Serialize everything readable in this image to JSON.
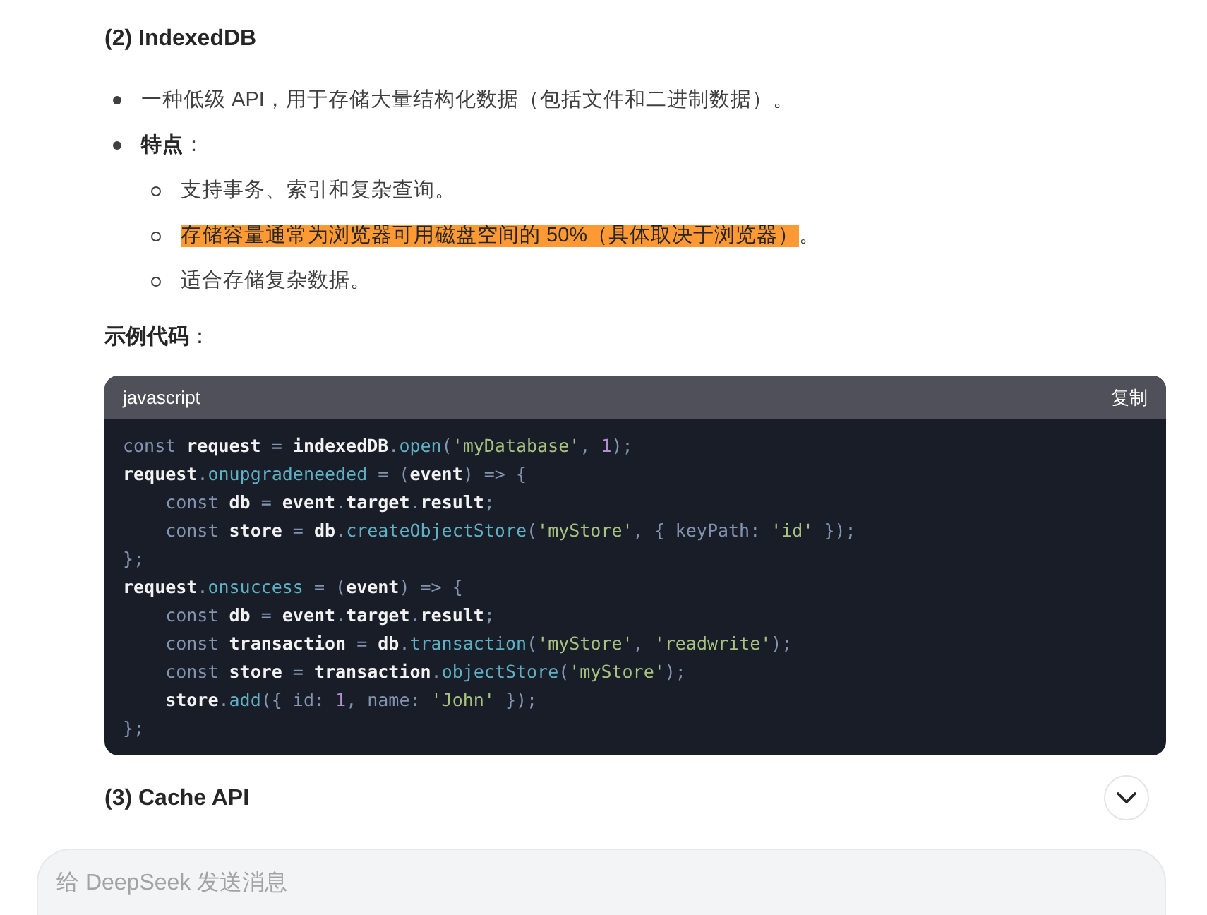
{
  "heading": "(2) IndexedDB",
  "bullets": [
    {
      "segments": [
        {
          "text": "一种低级 API，用于存储大量结构化数据（包括文件和二进制数据）。",
          "highlighted": false
        }
      ],
      "bold": false
    },
    {
      "segments": [
        {
          "text": "特点",
          "highlighted": false
        }
      ],
      "bold": true,
      "suffix": "：",
      "children": [
        {
          "segments": [
            {
              "text": "支持事务、索引和复杂查询。",
              "highlighted": false
            }
          ]
        },
        {
          "segments": [
            {
              "text": "存储容量通常为浏览器可用磁盘空间的 50%（具体取决于浏览器）",
              "highlighted": true
            },
            {
              "text": "。",
              "highlighted": false
            }
          ]
        },
        {
          "segments": [
            {
              "text": "适合存储复杂数据。",
              "highlighted": false
            }
          ]
        }
      ]
    }
  ],
  "example_label": "示例代码",
  "example_suffix": "：",
  "code_block": {
    "language": "javascript",
    "copy_label": "复制",
    "lines": [
      {
        "tokens": [
          {
            "kind": "kw",
            "text": "const "
          },
          {
            "kind": "id",
            "text": "request"
          },
          {
            "kind": "p",
            "text": " = "
          },
          {
            "kind": "id",
            "text": "indexedDB"
          },
          {
            "kind": "p",
            "text": "."
          },
          {
            "kind": "prop",
            "text": "open"
          },
          {
            "kind": "p",
            "text": "("
          },
          {
            "kind": "str",
            "text": "'myDatabase'"
          },
          {
            "kind": "p",
            "text": ", "
          },
          {
            "kind": "num",
            "text": "1"
          },
          {
            "kind": "p",
            "text": ");"
          }
        ]
      },
      {
        "tokens": [
          {
            "kind": "id",
            "text": "request"
          },
          {
            "kind": "p",
            "text": "."
          },
          {
            "kind": "prop",
            "text": "onupgradeneeded"
          },
          {
            "kind": "p",
            "text": " = ("
          },
          {
            "kind": "id",
            "text": "event"
          },
          {
            "kind": "p",
            "text": ") => {"
          }
        ]
      },
      {
        "tokens": [
          {
            "kind": "kw",
            "text": "    const "
          },
          {
            "kind": "id",
            "text": "db"
          },
          {
            "kind": "p",
            "text": " = "
          },
          {
            "kind": "id",
            "text": "event"
          },
          {
            "kind": "p",
            "text": "."
          },
          {
            "kind": "id",
            "text": "target"
          },
          {
            "kind": "p",
            "text": "."
          },
          {
            "kind": "id",
            "text": "result"
          },
          {
            "kind": "p",
            "text": ";"
          }
        ]
      },
      {
        "tokens": [
          {
            "kind": "kw",
            "text": "    const "
          },
          {
            "kind": "id",
            "text": "store"
          },
          {
            "kind": "p",
            "text": " = "
          },
          {
            "kind": "id",
            "text": "db"
          },
          {
            "kind": "p",
            "text": "."
          },
          {
            "kind": "prop",
            "text": "createObjectStore"
          },
          {
            "kind": "p",
            "text": "("
          },
          {
            "kind": "str",
            "text": "'myStore'"
          },
          {
            "kind": "p",
            "text": ", { keyPath: "
          },
          {
            "kind": "str",
            "text": "'id'"
          },
          {
            "kind": "p",
            "text": " });"
          }
        ]
      },
      {
        "tokens": [
          {
            "kind": "p",
            "text": "};"
          }
        ]
      },
      {
        "tokens": [
          {
            "kind": "id",
            "text": "request"
          },
          {
            "kind": "p",
            "text": "."
          },
          {
            "kind": "prop",
            "text": "onsuccess"
          },
          {
            "kind": "p",
            "text": " = ("
          },
          {
            "kind": "id",
            "text": "event"
          },
          {
            "kind": "p",
            "text": ") => {"
          }
        ]
      },
      {
        "tokens": [
          {
            "kind": "kw",
            "text": "    const "
          },
          {
            "kind": "id",
            "text": "db"
          },
          {
            "kind": "p",
            "text": " = "
          },
          {
            "kind": "id",
            "text": "event"
          },
          {
            "kind": "p",
            "text": "."
          },
          {
            "kind": "id",
            "text": "target"
          },
          {
            "kind": "p",
            "text": "."
          },
          {
            "kind": "id",
            "text": "result"
          },
          {
            "kind": "p",
            "text": ";"
          }
        ]
      },
      {
        "tokens": [
          {
            "kind": "kw",
            "text": "    const "
          },
          {
            "kind": "id",
            "text": "transaction"
          },
          {
            "kind": "p",
            "text": " = "
          },
          {
            "kind": "id",
            "text": "db"
          },
          {
            "kind": "p",
            "text": "."
          },
          {
            "kind": "prop",
            "text": "transaction"
          },
          {
            "kind": "p",
            "text": "("
          },
          {
            "kind": "str",
            "text": "'myStore'"
          },
          {
            "kind": "p",
            "text": ", "
          },
          {
            "kind": "str",
            "text": "'readwrite'"
          },
          {
            "kind": "p",
            "text": ");"
          }
        ]
      },
      {
        "tokens": [
          {
            "kind": "kw",
            "text": "    const "
          },
          {
            "kind": "id",
            "text": "store"
          },
          {
            "kind": "p",
            "text": " = "
          },
          {
            "kind": "id",
            "text": "transaction"
          },
          {
            "kind": "p",
            "text": "."
          },
          {
            "kind": "prop",
            "text": "objectStore"
          },
          {
            "kind": "p",
            "text": "("
          },
          {
            "kind": "str",
            "text": "'myStore'"
          },
          {
            "kind": "p",
            "text": ");"
          }
        ]
      },
      {
        "tokens": [
          {
            "kind": "id",
            "text": "    store"
          },
          {
            "kind": "p",
            "text": "."
          },
          {
            "kind": "prop",
            "text": "add"
          },
          {
            "kind": "p",
            "text": "({ id: "
          },
          {
            "kind": "num",
            "text": "1"
          },
          {
            "kind": "p",
            "text": ", name: "
          },
          {
            "kind": "str",
            "text": "'John'"
          },
          {
            "kind": "p",
            "text": " });"
          }
        ]
      },
      {
        "tokens": [
          {
            "kind": "p",
            "text": "};"
          }
        ]
      }
    ]
  },
  "next_heading": "(3) Cache API",
  "message_input": {
    "placeholder": "给 DeepSeek 发送消息"
  }
}
